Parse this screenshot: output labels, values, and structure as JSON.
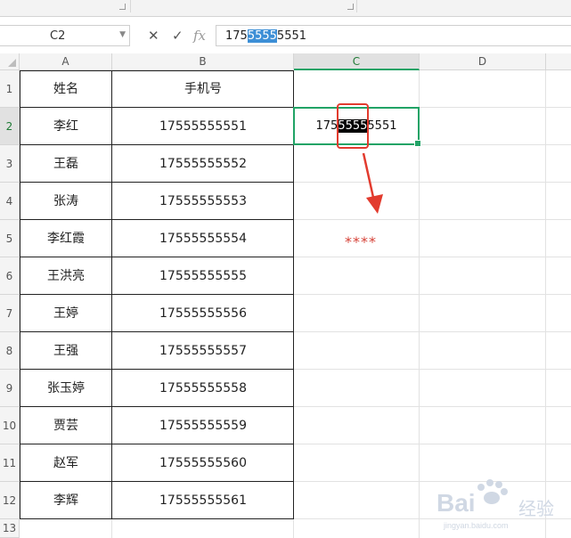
{
  "formula_bar": {
    "name_box": "C2",
    "cancel_glyph": "✕",
    "confirm_glyph": "✓",
    "fx_label": "fx",
    "value_before": "175",
    "value_selected": "5555",
    "value_after": "5551"
  },
  "columns": [
    "A",
    "B",
    "C",
    "D"
  ],
  "rows": [
    "1",
    "2",
    "3",
    "4",
    "5",
    "6",
    "7",
    "8",
    "9",
    "10",
    "11",
    "12",
    "13"
  ],
  "table": {
    "headers": [
      "姓名",
      "手机号"
    ],
    "records": [
      {
        "name": "李红",
        "phone": "17555555551"
      },
      {
        "name": "王磊",
        "phone": "17555555552"
      },
      {
        "name": "张涛",
        "phone": "17555555553"
      },
      {
        "name": "李红霞",
        "phone": "17555555554"
      },
      {
        "name": "王洪亮",
        "phone": "17555555555"
      },
      {
        "name": "王婷",
        "phone": "17555555556"
      },
      {
        "name": "王强",
        "phone": "17555555557"
      },
      {
        "name": "张玉婷",
        "phone": "17555555558"
      },
      {
        "name": "贾芸",
        "phone": "17555555559"
      },
      {
        "name": "赵军",
        "phone": "17555555560"
      },
      {
        "name": "李辉",
        "phone": "17555555561"
      }
    ]
  },
  "cell_c2": {
    "before": "175",
    "highlighted": "5555",
    "after": "5551"
  },
  "annotation": {
    "mask_text": "****",
    "color": "#e23b2e"
  },
  "watermark": {
    "brand": "Bai",
    "cn": "经验",
    "url": "jingyan.baidu.com"
  },
  "colors": {
    "selection": "#21a366",
    "header_bg": "#f4f4f4"
  }
}
